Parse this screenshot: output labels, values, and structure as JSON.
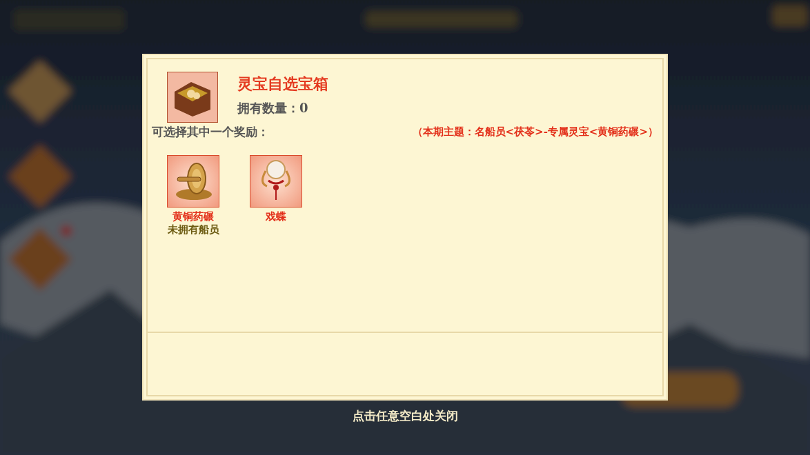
{
  "chest": {
    "name": "灵宝自选宝箱",
    "owned": "拥有数量：0"
  },
  "prompt": "可选择其中一个奖励：",
  "theme": "（本期主题：名船员<茯苓>-专属灵宝<黄铜药碾>）",
  "rewards": [
    {
      "kind": "grinder",
      "name": "黄铜药碾",
      "note": "未拥有船员"
    },
    {
      "kind": "drum",
      "name": "戏蝶"
    }
  ],
  "close_hint": "点击任意空白处关闭"
}
